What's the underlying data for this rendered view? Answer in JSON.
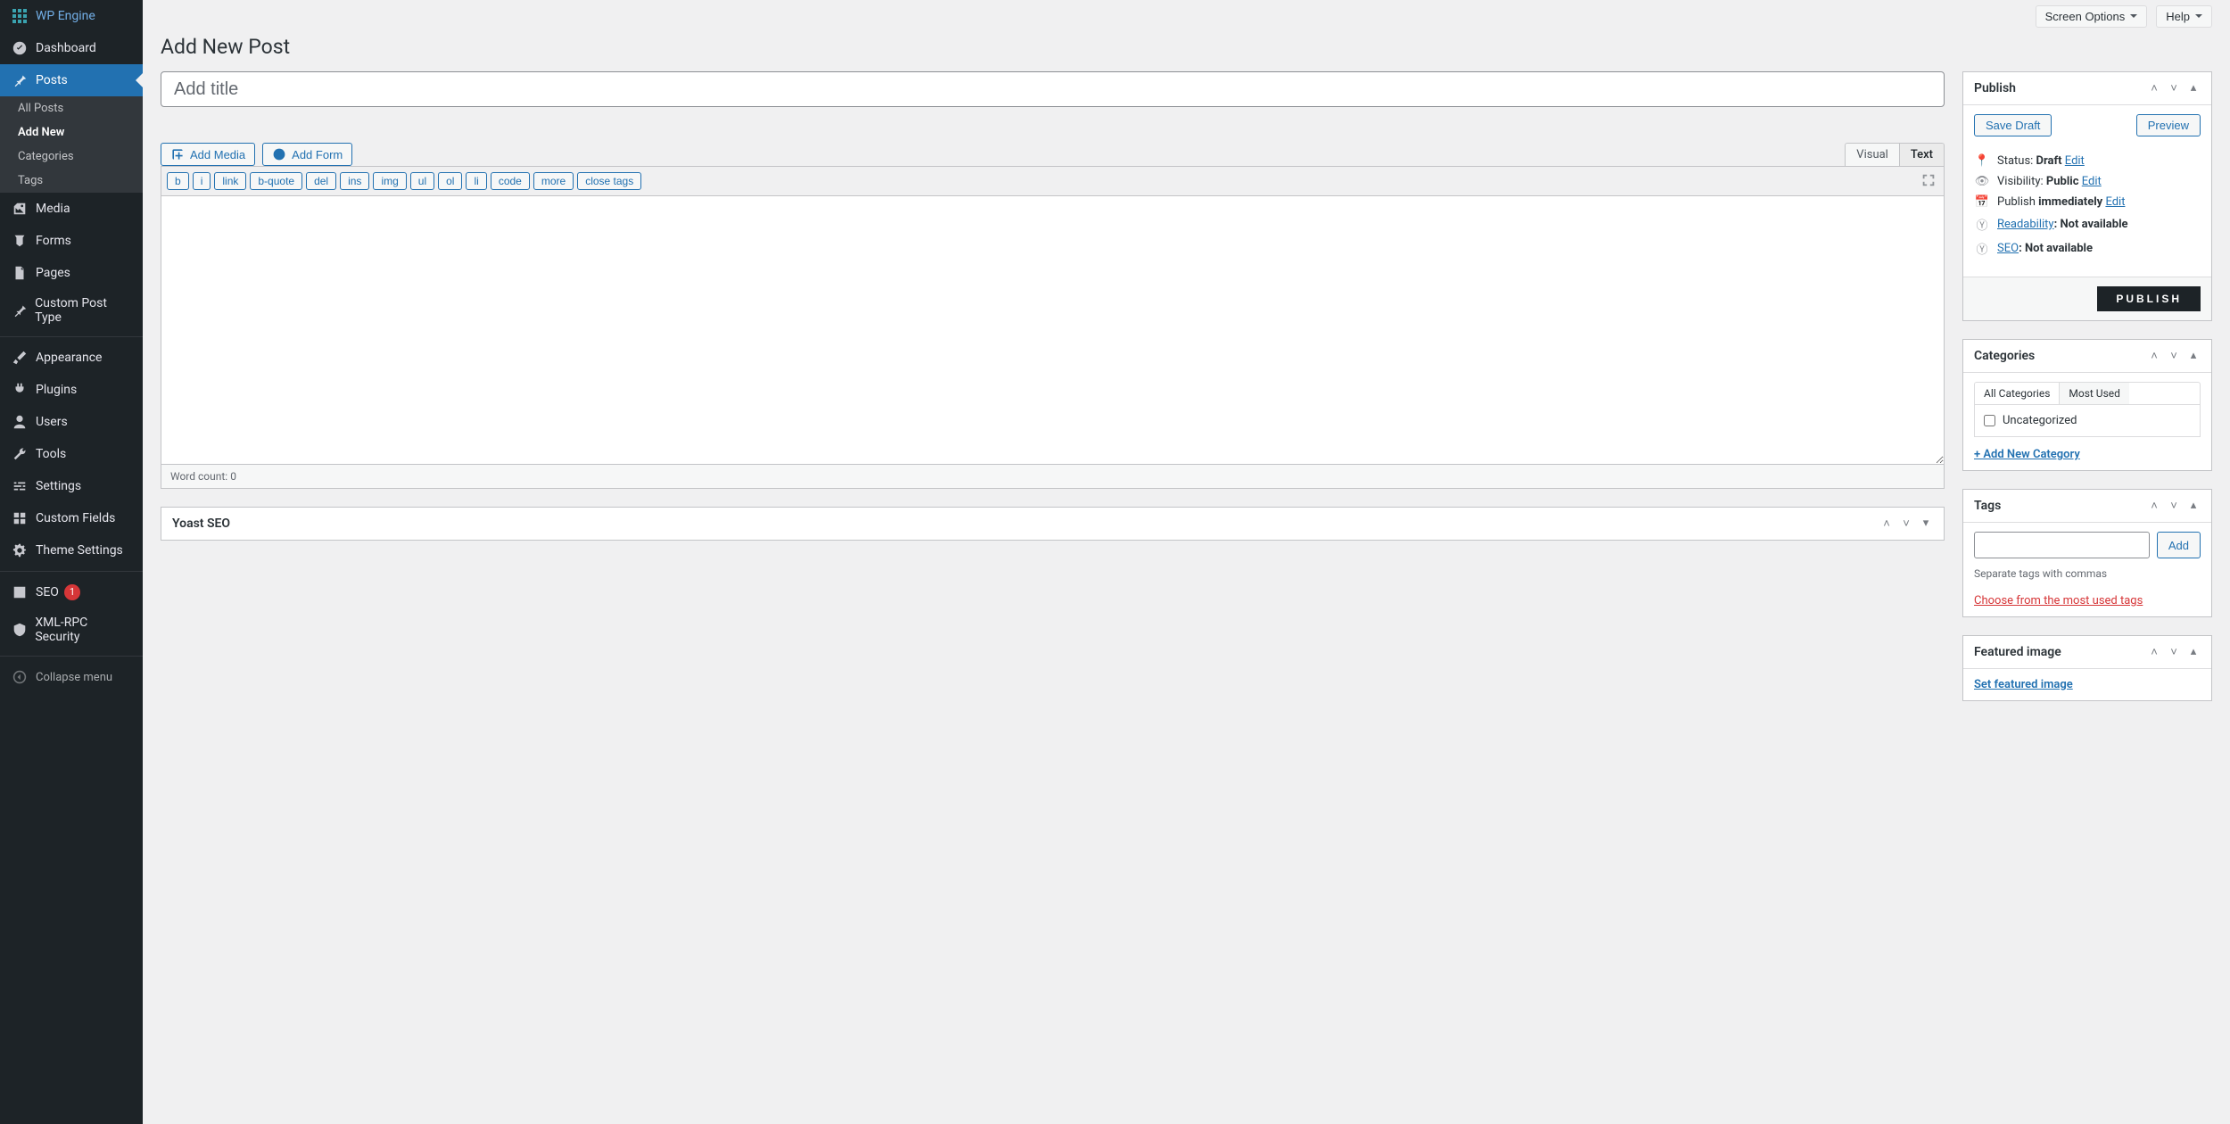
{
  "topbar": {
    "screen_options": "Screen Options",
    "help": "Help"
  },
  "page_title": "Add New Post",
  "title_placeholder": "Add title",
  "sidebar": {
    "items": [
      {
        "key": "wpengine",
        "label": "WP Engine"
      },
      {
        "key": "dashboard",
        "label": "Dashboard"
      },
      {
        "key": "posts",
        "label": "Posts",
        "current": true
      },
      {
        "key": "media",
        "label": "Media"
      },
      {
        "key": "forms",
        "label": "Forms"
      },
      {
        "key": "pages",
        "label": "Pages"
      },
      {
        "key": "cpt",
        "label": "Custom Post Type"
      },
      {
        "key": "appearance",
        "label": "Appearance"
      },
      {
        "key": "plugins",
        "label": "Plugins"
      },
      {
        "key": "users",
        "label": "Users"
      },
      {
        "key": "tools",
        "label": "Tools"
      },
      {
        "key": "settings",
        "label": "Settings"
      },
      {
        "key": "customfields",
        "label": "Custom Fields"
      },
      {
        "key": "themesettings",
        "label": "Theme Settings"
      },
      {
        "key": "seo",
        "label": "SEO",
        "badge": "1"
      },
      {
        "key": "xmlrpc",
        "label": "XML-RPC Security"
      }
    ],
    "posts_sub": [
      {
        "label": "All Posts"
      },
      {
        "label": "Add New"
      },
      {
        "label": "Categories"
      },
      {
        "label": "Tags"
      }
    ],
    "collapse": "Collapse menu"
  },
  "editor": {
    "add_media": "Add Media",
    "add_form": "Add Form",
    "tab_visual": "Visual",
    "tab_text": "Text",
    "quicktags": [
      "b",
      "i",
      "link",
      "b-quote",
      "del",
      "ins",
      "img",
      "ul",
      "ol",
      "li",
      "code",
      "more",
      "close tags"
    ],
    "word_count_label": "Word count: ",
    "word_count": "0"
  },
  "yoast": {
    "title": "Yoast SEO"
  },
  "publish": {
    "title": "Publish",
    "save_draft": "Save Draft",
    "preview": "Preview",
    "status_label": "Status: ",
    "status_value": "Draft",
    "visibility_label": "Visibility: ",
    "visibility_value": "Public",
    "publish_label": "Publish ",
    "publish_value": "immediately",
    "readability_label": "Readability",
    "readability_value": ": Not available",
    "seo_label": "SEO",
    "seo_value": ": Not available",
    "edit": "Edit",
    "publish_btn": "PUBLISH"
  },
  "categories": {
    "title": "Categories",
    "tab_all": "All Categories",
    "tab_most": "Most Used",
    "items": [
      {
        "label": "Uncategorized"
      }
    ],
    "add_new": "+ Add New Category"
  },
  "tags": {
    "title": "Tags",
    "add": "Add",
    "hint": "Separate tags with commas",
    "choose": "Choose from the most used tags"
  },
  "featured": {
    "title": "Featured image",
    "set": "Set featured image"
  }
}
